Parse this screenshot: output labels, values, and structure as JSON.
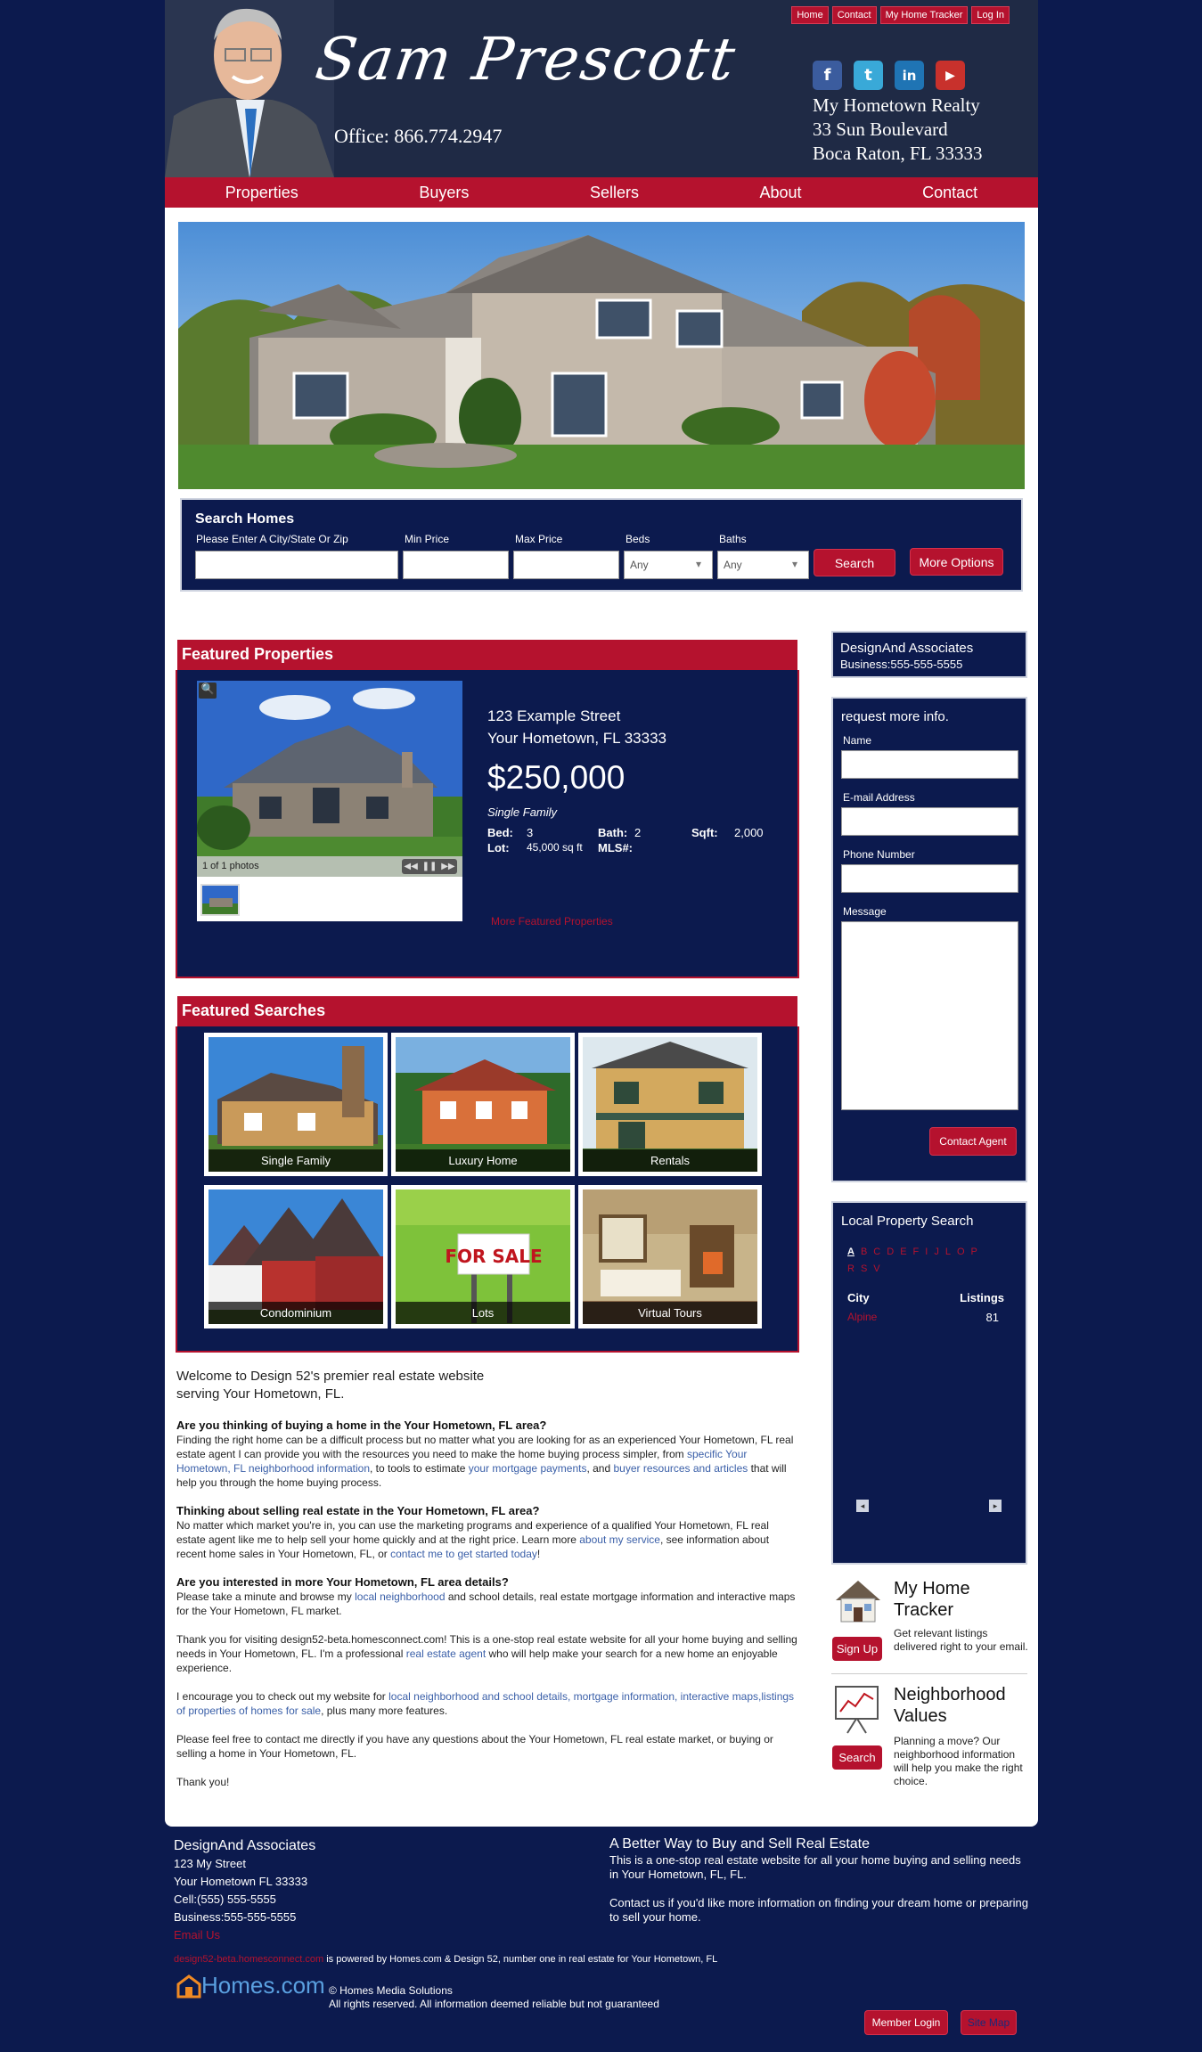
{
  "header": {
    "agent_name": "Sam Prescott",
    "office_phone": "Office: 866.774.2947",
    "top_links": [
      "Home",
      "Contact",
      "My Home Tracker",
      "Log In"
    ],
    "address_lines": [
      "My Hometown Realty",
      "33 Sun Boulevard",
      "Boca Raton, FL 33333"
    ],
    "social_icons": [
      "facebook-icon",
      "twitter-icon",
      "linkedin-icon",
      "youtube-icon"
    ]
  },
  "nav": [
    "Properties",
    "Buyers",
    "Sellers",
    "About",
    "Contact"
  ],
  "search": {
    "title": "Search Homes",
    "location_label": "Please Enter A City/State Or Zip",
    "min_price_label": "Min Price",
    "max_price_label": "Max Price",
    "beds_label": "Beds",
    "beds_value": "Any",
    "baths_label": "Baths",
    "baths_value": "Any",
    "search_button": "Search",
    "more_options_button": "More Options"
  },
  "featured_properties": {
    "title": "Featured Properties",
    "street": "123 Example Street",
    "city_line": "Your Hometown, FL 33333",
    "price": "$250,000",
    "type": "Single Family",
    "bed_label": "Bed:",
    "bed_value": "3",
    "bath_label": "Bath:",
    "bath_value": "2",
    "sqft_label": "Sqft:",
    "sqft_value": "2,000",
    "lot_label": "Lot:",
    "lot_value": "45,000 sq ft",
    "mls_label": "MLS#:",
    "photo_count": "1 of 1 photos",
    "more_link": "More Featured Properties"
  },
  "featured_searches": {
    "title": "Featured Searches",
    "tiles": [
      "Single Family",
      "Luxury Home",
      "Rentals",
      "Condominium",
      "Lots",
      "Virtual Tours"
    ],
    "for_sale_sign": "FOR SALE"
  },
  "content": {
    "welcome": "Welcome to Design 52's premier real estate website serving Your Hometown, FL.",
    "buy_heading": "Are you thinking of buying a home in the Your Hometown, FL area?",
    "buy_text_1": "Finding the right home can be a difficult process but no matter what you are looking for as an experienced Your Hometown, FL real estate agent I can provide you with the resources you need to make the home buying process simpler, from ",
    "buy_link_1": "specific Your Hometown, FL neighborhood information",
    "buy_text_2": ", to tools to estimate ",
    "buy_link_2": "your mortgage payments",
    "buy_text_3": ", and ",
    "buy_link_3": "buyer resources and articles",
    "buy_text_4": " that will help you through the home buying process.",
    "sell_heading": "Thinking about selling real estate in the Your Hometown, FL area?",
    "sell_text_1": "No matter which market you're in, you can use the marketing programs and experience of a qualified Your Hometown, FL real estate agent like me to help sell your home quickly and at the right price. Learn more ",
    "sell_link_1": "about my service",
    "sell_text_2": ", see information about recent home sales in Your Hometown, FL, or ",
    "sell_link_2": "contact me to get started today",
    "sell_text_3": "!",
    "more_heading": "Are you interested in more Your Hometown, FL area details?",
    "more_text_1": "Please take a minute and browse my ",
    "more_link_1": "local neighborhood",
    "more_text_2": " and school details, real estate mortgage information and interactive maps for the Your Hometown, FL market.",
    "thanks_text_1": "Thank you for visiting design52-beta.homesconnect.com! This is a one-stop real estate website for all your home buying and selling needs in Your Hometown, FL. I'm a professional ",
    "thanks_link": "real estate agent",
    "thanks_text_2": " who will help make your search for a new home an enjoyable experience.",
    "encourage_text_1": "I encourage you to check out my website for ",
    "encourage_link": "local neighborhood and school details, mortgage information, interactive maps,listings of properties of homes for sale",
    "encourage_text_2": ", plus many more features.",
    "contact_text": "Please feel free to contact me directly if you have any questions about the Your Hometown, FL real estate market, or buying or selling a home in Your Hometown, FL.",
    "thank_you": "Thank you!"
  },
  "sidebar": {
    "company": "DesignAnd Associates",
    "business_phone": "Business:555-555-5555",
    "form_title": "request more info.",
    "name_label": "Name",
    "email_label": "E-mail Address",
    "phone_label": "Phone Number",
    "message_label": "Message",
    "contact_button": "Contact Agent",
    "lps_title": "Local Property Search",
    "letters": [
      "A",
      "B",
      "C",
      "D",
      "E",
      "F",
      "I",
      "J",
      "L",
      "O",
      "P",
      "R",
      "S",
      "V"
    ],
    "city_header": "City",
    "listings_header": "Listings",
    "city": "Alpine",
    "city_count": "81",
    "tracker_title_1": "My Home",
    "tracker_title_2": "Tracker",
    "tracker_text": "Get relevant listings delivered right to your email.",
    "tracker_button": "Sign Up",
    "values_title_1": "Neighborhood",
    "values_title_2": "Values",
    "values_text": "Planning a move? Our neighborhood information will help you make the right choice.",
    "values_button": "Search"
  },
  "footer": {
    "company": "DesignAnd Associates",
    "street": "123 My Street",
    "city": "Your Hometown FL 33333",
    "cell": "Cell:(555) 555-5555",
    "business": "Business:555-555-5555",
    "email_link": "Email Us",
    "tagline_title": "A Better Way to Buy and Sell Real Estate",
    "tagline_text": "This is a one-stop real estate website for all your home buying and selling needs in Your Hometown, FL, FL.",
    "tagline_text_2": "Contact us if you'd like more information on finding your dream home or preparing to sell your home.",
    "powered_site": "design52-beta.homesconnect.com",
    "powered_text": " is powered by Homes.com & Design 52, number one in real estate for Your Hometown, FL",
    "logo_text": "Homes.com",
    "copyright": "© Homes Media Solutions",
    "disclaimer": "All rights reserved. All information deemed reliable but not guaranteed",
    "member_login": "Member Login",
    "site_map": "Site Map"
  },
  "colors": {
    "navy": "#0c1a4e",
    "header_bg": "#1f2a45",
    "accent_red": "#b5122e",
    "link_blue": "#3a5fa8"
  }
}
